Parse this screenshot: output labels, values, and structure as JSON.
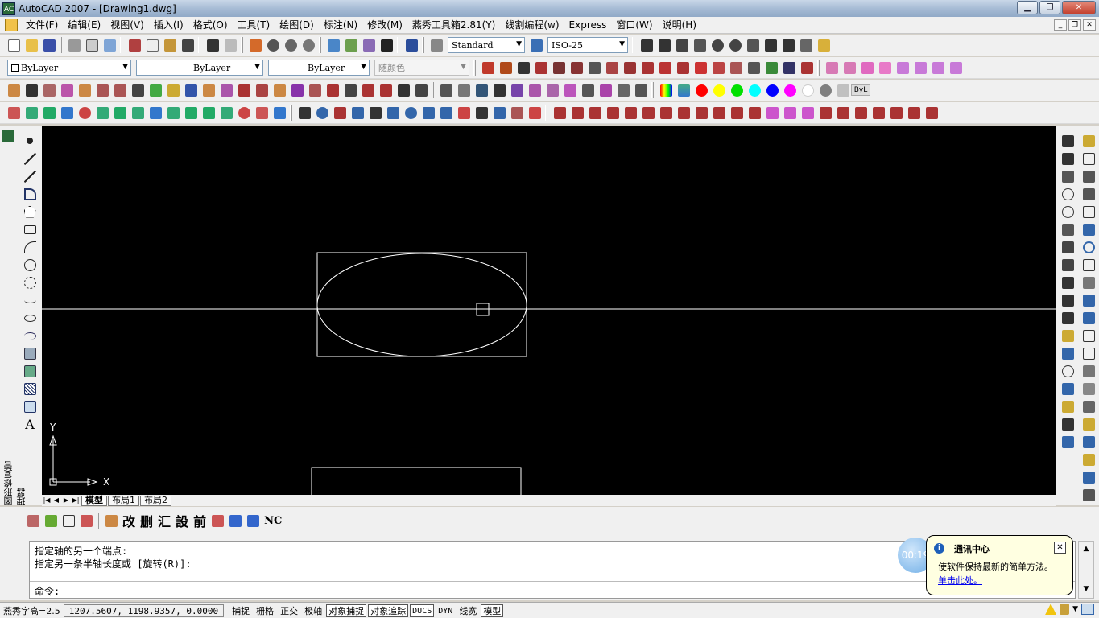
{
  "window": {
    "title": "AutoCAD 2007 - [Drawing1.dwg]",
    "app_icon_label": "AC"
  },
  "menu": [
    "文件(F)",
    "编辑(E)",
    "视图(V)",
    "插入(I)",
    "格式(O)",
    "工具(T)",
    "绘图(D)",
    "标注(N)",
    "修改(M)",
    "燕秀工具箱2.81(Y)",
    "线割编程(w)",
    "Express",
    "窗口(W)",
    "说明(H)"
  ],
  "styles": {
    "text_style": "Standard",
    "dim_style": "ISO-25"
  },
  "properties": {
    "layer_combo": "ByLayer",
    "linetype_combo": "ByLayer",
    "lineweight_combo": "ByLayer",
    "color_combo": "随颜色"
  },
  "bylayer_swatch": "ByL",
  "colors": [
    "#ff0000",
    "#ffff00",
    "#00e000",
    "#00ffff",
    "#0000ff",
    "#ff00ff",
    "#ffffff",
    "#808080",
    "#c0c0c0"
  ],
  "left_panel_label": "图形修复管理器",
  "ucs": {
    "x_label": "X",
    "y_label": "Y"
  },
  "layout_tabs": [
    "模型",
    "布局1",
    "布局2"
  ],
  "bottom_toolbar_text": [
    "改",
    "删",
    "汇",
    "設",
    "前",
    "NC"
  ],
  "command_line": {
    "line1": "指定轴的另一个端点:",
    "line2": "指定另一条半轴长度或 [旋转(R)]:",
    "prompt": "命令:"
  },
  "status": {
    "text_height": "燕秀字高=2.5",
    "coordinates": "1207.5607, 1198.9357, 0.0000",
    "buttons": [
      {
        "label": "捕捉",
        "on": false
      },
      {
        "label": "栅格",
        "on": false
      },
      {
        "label": "正交",
        "on": false
      },
      {
        "label": "极轴",
        "on": false
      },
      {
        "label": "对象捕捉",
        "on": true
      },
      {
        "label": "对象追踪",
        "on": true
      },
      {
        "label": "DUCS",
        "on": true
      },
      {
        "label": "DYN",
        "on": false
      },
      {
        "label": "线宽",
        "on": false
      },
      {
        "label": "模型",
        "on": true
      }
    ]
  },
  "notification": {
    "timer": "00:19",
    "title": "通讯中心",
    "message": "使软件保持最新的简单方法。",
    "link": "单击此处。"
  }
}
